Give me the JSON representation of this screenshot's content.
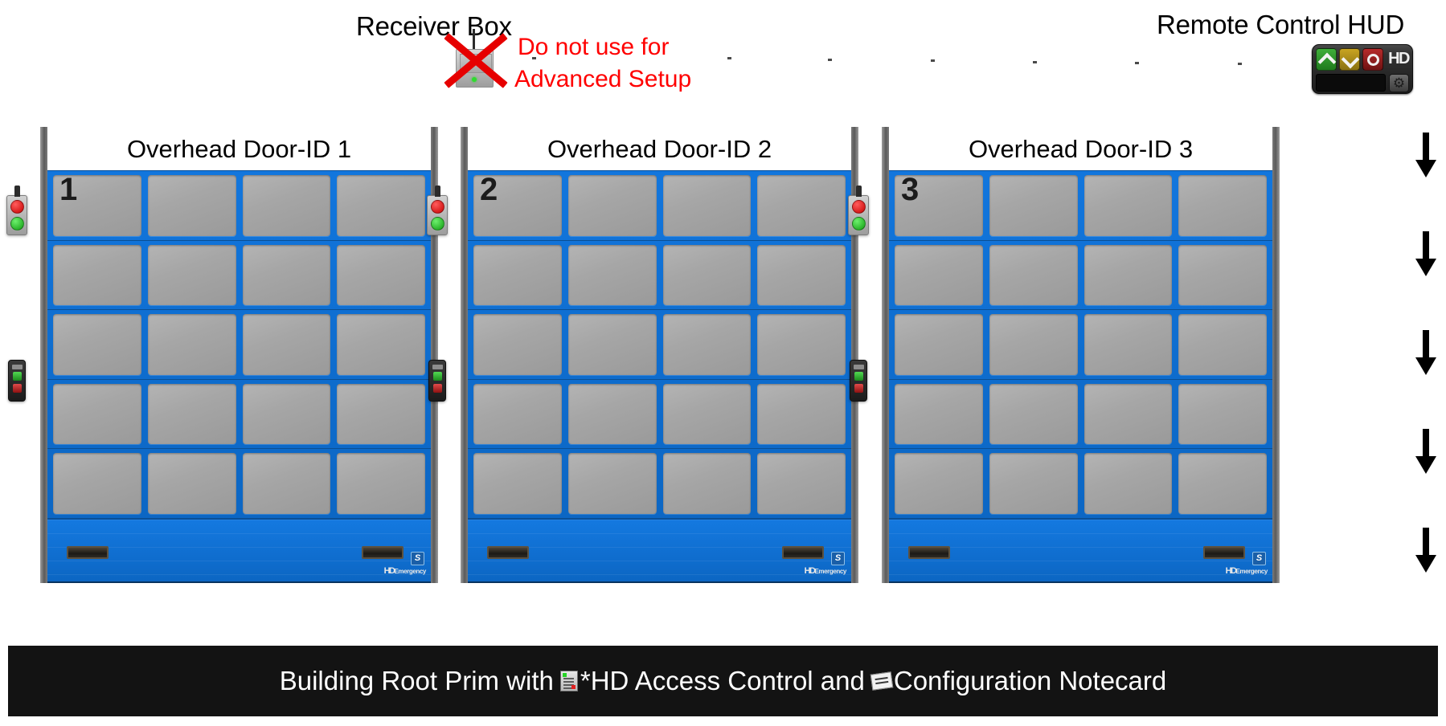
{
  "receiver": {
    "label": "Receiver Box",
    "warning_line1": "Do not use for",
    "warning_line2": "Advanced Setup",
    "warning_color": "#ff0000",
    "x_mark_color": "#e60000",
    "led_color": "#2fdb2f"
  },
  "hud": {
    "label": "Remote Control HUD",
    "logo": "HD",
    "buttons": [
      {
        "name": "open-up",
        "icon": "chevron-up-icon",
        "color": "#3fae3a"
      },
      {
        "name": "close-down",
        "icon": "chevron-down-icon",
        "color": "#c8a421"
      },
      {
        "name": "stop",
        "icon": "circle-stop-icon",
        "color": "#b62b2b"
      }
    ],
    "display_value": "",
    "settings_icon": "gear-icon"
  },
  "doors": [
    {
      "title": "Overhead Door-ID 1",
      "number": "1",
      "body_color": "#0e6ccd",
      "panel_color": "#a6a6a6",
      "rows": 5,
      "columns": 4,
      "badge": "S",
      "brand": "HD",
      "brand_suffix": "Emergency",
      "controls": [
        {
          "name": "traffic-light-panel",
          "lamps": [
            "red",
            "green"
          ]
        },
        {
          "name": "wall-switch-panel",
          "buttons": [
            "green",
            "red"
          ]
        }
      ]
    },
    {
      "title": "Overhead Door-ID 2",
      "number": "2",
      "body_color": "#0e6ccd",
      "panel_color": "#a6a6a6",
      "rows": 5,
      "columns": 4,
      "badge": "S",
      "brand": "HD",
      "brand_suffix": "Emergency",
      "controls": [
        {
          "name": "traffic-light-panel",
          "lamps": [
            "red",
            "green"
          ]
        },
        {
          "name": "wall-switch-panel",
          "buttons": [
            "green",
            "red"
          ]
        }
      ]
    },
    {
      "title": "Overhead Door-ID 3",
      "number": "3",
      "body_color": "#0e6ccd",
      "panel_color": "#a6a6a6",
      "rows": 5,
      "columns": 4,
      "badge": "S",
      "brand": "HD",
      "brand_suffix": "Emergency",
      "controls": [
        {
          "name": "traffic-light-panel",
          "lamps": [
            "red",
            "green"
          ]
        },
        {
          "name": "wall-switch-panel",
          "buttons": [
            "green",
            "red"
          ]
        }
      ]
    }
  ],
  "side_arrows": {
    "icon": "arrow-down-icon",
    "count": 5,
    "color": "#000000"
  },
  "banner": {
    "background": "#131313",
    "text_color": "#ffffff",
    "part1": "Building Root Prim with ",
    "script_icon": "script-icon",
    "part2": "*HD Access Control and ",
    "notecard_icon": "notecard-icon",
    "part3": "Configuration Notecard"
  }
}
